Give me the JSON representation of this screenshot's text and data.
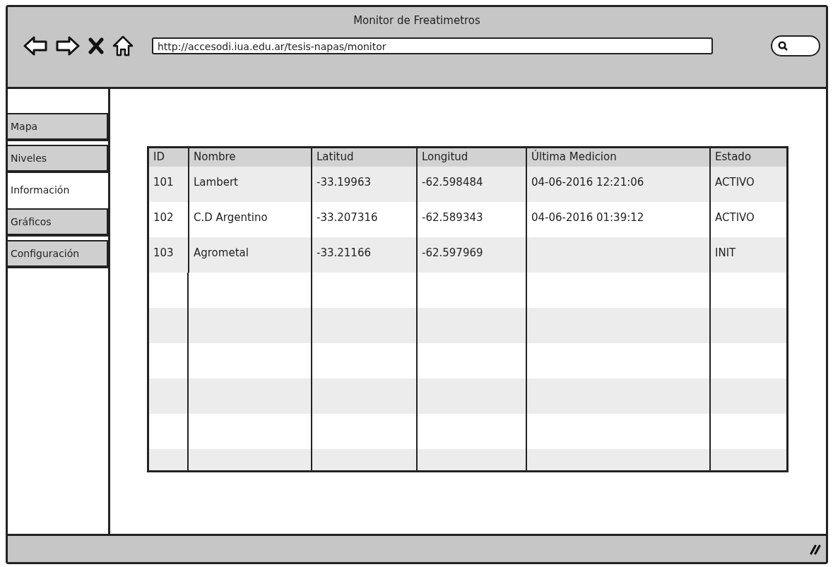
{
  "window": {
    "title": "Monitor de Freatimetros"
  },
  "address_bar": {
    "value": "http://accesodi.iua.edu.ar/tesis-napas/monitor"
  },
  "tabs": [
    {
      "label": "Mapa",
      "selected": false
    },
    {
      "label": "Niveles",
      "selected": false
    },
    {
      "label": "Información",
      "selected": true
    },
    {
      "label": "Gráficos",
      "selected": false
    },
    {
      "label": "Configuración",
      "selected": false
    }
  ],
  "table": {
    "columns": [
      "ID",
      "Nombre",
      "Latitud",
      "Longitud",
      "Última Medicion",
      "Estado"
    ],
    "rows": [
      [
        "101",
        "Lambert",
        "-33.19963",
        "-62.598484",
        "04-06-2016 12:21:06",
        "ACTIVO"
      ],
      [
        "102",
        "C.D Argentino",
        "-33.207316",
        "-62.589343",
        "04-06-2016 01:39:12",
        "ACTIVO"
      ],
      [
        "103",
        "Agrometal",
        "-33.21166",
        "-62.597969",
        "",
        "INIT"
      ]
    ]
  }
}
